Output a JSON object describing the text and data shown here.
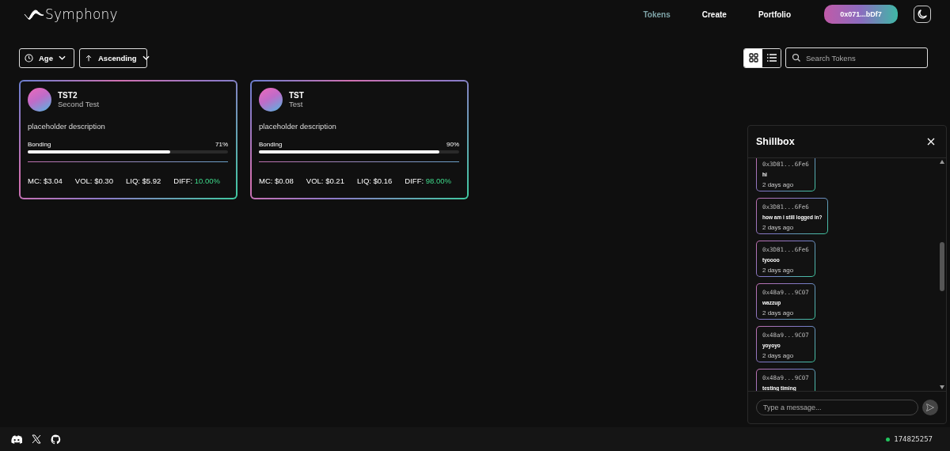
{
  "brand": {
    "name": "Symphony"
  },
  "nav": [
    {
      "label": "Tokens",
      "selected": true
    },
    {
      "label": "Create",
      "selected": false
    },
    {
      "label": "Portfolio",
      "selected": false
    }
  ],
  "wallet": {
    "label": "0x071...bDf7"
  },
  "sort": [
    {
      "kind": "age",
      "label": "Age"
    },
    {
      "kind": "order",
      "label": "Ascending"
    }
  ],
  "views": [
    {
      "kind": "grid",
      "selected": true
    },
    {
      "kind": "list",
      "selected": false
    }
  ],
  "search": {
    "placeholder": "Search Tokens"
  },
  "tokens": [
    {
      "symbol": "TST2",
      "name": "Second Test",
      "description": "placeholder description",
      "bonding_label": "Bonding",
      "bonding_pct": "71%",
      "level": 0.71,
      "mc": "MC: $3.04",
      "vol": "VOL: $0.30",
      "liq": "LIQ: $5.92",
      "diff_label": "DIFF:",
      "diff": "10.00%"
    },
    {
      "symbol": "TST",
      "name": "Test",
      "description": "placeholder description",
      "bonding_label": "Bonding",
      "bonding_pct": "90%",
      "level": 0.9,
      "mc": "MC: $0.08",
      "vol": "VOL: $0.21",
      "liq": "LIQ: $0.16",
      "diff_label": "DIFF:",
      "diff": "98.00%"
    }
  ],
  "shillbox": {
    "title": "Shillbox",
    "messages": [
      {
        "address": "0x3D81...6Fe6",
        "text": "hi",
        "time": "2 days ago"
      },
      {
        "address": "0x3D81...6Fe6",
        "text": "how am i still logged in?",
        "time": "2 days ago"
      },
      {
        "address": "0x3D81...6Fe6",
        "text": "tyoooo",
        "time": "2 days ago"
      },
      {
        "address": "0x48a9...9C07",
        "text": "wazzup",
        "time": "2 days ago"
      },
      {
        "address": "0x48a9...9C07",
        "text": "yoyoyo",
        "time": "2 days ago"
      },
      {
        "address": "0x48a9...9C07",
        "text": "testing timing"
      }
    ],
    "input_placeholder": "Type a message..."
  },
  "footer": {
    "block": "174825257"
  }
}
